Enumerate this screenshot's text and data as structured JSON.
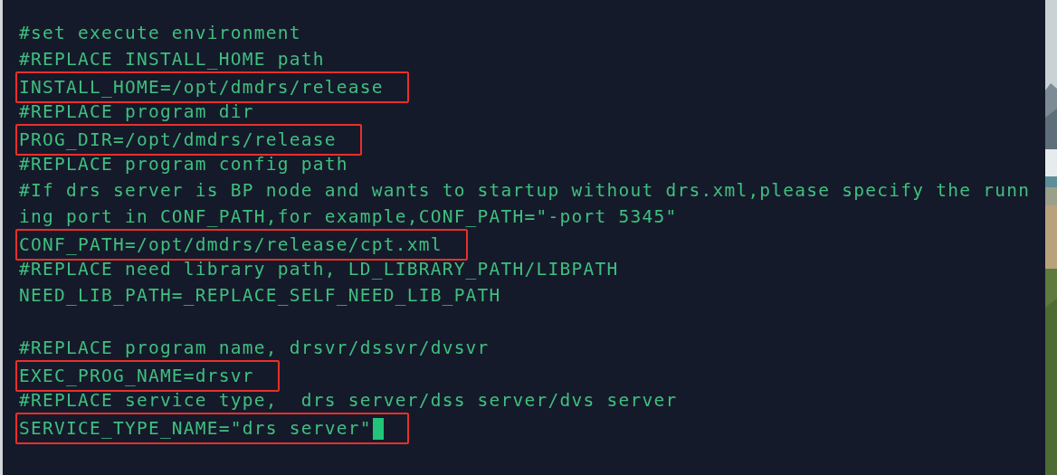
{
  "terminal": {
    "lines": [
      {
        "kind": "text",
        "text": "#set execute environment",
        "boxed": false
      },
      {
        "kind": "text",
        "text": "#REPLACE INSTALL_HOME path",
        "boxed": false
      },
      {
        "kind": "text",
        "text": "INSTALL_HOME=/opt/dmdrs/release",
        "boxed": true
      },
      {
        "kind": "text",
        "text": "#REPLACE program dir",
        "boxed": false
      },
      {
        "kind": "text",
        "text": "PROG_DIR=/opt/dmdrs/release",
        "boxed": true
      },
      {
        "kind": "text",
        "text": "#REPLACE program config path",
        "boxed": false
      },
      {
        "kind": "text",
        "text": "#If drs server is BP node and wants to startup without drs.xml,please specify the runn",
        "boxed": false
      },
      {
        "kind": "text",
        "text": "ing port in CONF_PATH,for example,CONF_PATH=\"-port 5345\"",
        "boxed": false
      },
      {
        "kind": "text",
        "text": "CONF_PATH=/opt/dmdrs/release/cpt.xml",
        "boxed": true
      },
      {
        "kind": "text",
        "text": "#REPLACE need library path, LD_LIBRARY_PATH/LIBPATH",
        "boxed": false
      },
      {
        "kind": "text",
        "text": "NEED_LIB_PATH=_REPLACE_SELF_NEED_LIB_PATH",
        "boxed": false
      },
      {
        "kind": "blank"
      },
      {
        "kind": "text",
        "text": "#REPLACE program name, drsvr/dssvr/dvsvr",
        "boxed": false
      },
      {
        "kind": "text",
        "text": "EXEC_PROG_NAME=drsvr",
        "boxed": true
      },
      {
        "kind": "text",
        "text": "#REPLACE service type,  drs server/dss server/dvs server",
        "boxed": false
      },
      {
        "kind": "text",
        "text": "SERVICE_TYPE_NAME=\"drs server\"",
        "boxed": true,
        "cursor": true
      }
    ]
  }
}
